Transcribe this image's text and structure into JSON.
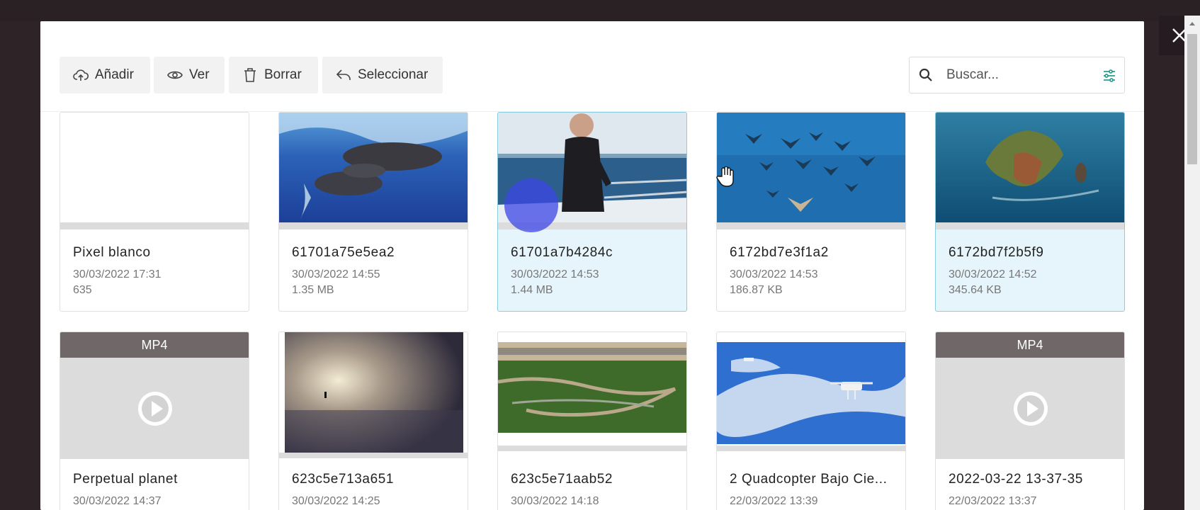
{
  "toolbar": {
    "add_label": "Añadir",
    "view_label": "Ver",
    "delete_label": "Borrar",
    "select_label": "Seleccionar"
  },
  "search": {
    "placeholder": "Buscar..."
  },
  "colors": {
    "selected_card_bg": "#e6f5fc",
    "selected_card_border": "#8ccbe0",
    "video_label_bg": "#706769"
  },
  "files": [
    {
      "name": "Pixel blanco",
      "date": "30/03/2022 17:31",
      "size": "635",
      "kind": "blank",
      "selected": false
    },
    {
      "name": "61701a75e5ea2",
      "date": "30/03/2022 14:55",
      "size": "1.35 MB",
      "kind": "image",
      "picture": "sperm whales underwater",
      "selected": false
    },
    {
      "name": "61701a7b4284c",
      "date": "30/03/2022 14:53",
      "size": "1.44 MB",
      "kind": "image",
      "picture": "diver on boat",
      "selected": true
    },
    {
      "name": "6172bd7e3f1a2",
      "date": "30/03/2022 14:53",
      "size": "186.87 KB",
      "kind": "image",
      "picture": "school of manta rays",
      "selected": false
    },
    {
      "name": "6172bd7f2b5f9",
      "date": "30/03/2022 14:52",
      "size": "345.64 KB",
      "kind": "image",
      "picture": "aerial island",
      "selected": true
    },
    {
      "name": "Perpetual planet",
      "date": "30/03/2022 14:37",
      "kind": "video",
      "type_label": "MP4",
      "selected": false
    },
    {
      "name": "623c5e713a651",
      "date": "30/03/2022 14:25",
      "kind": "image",
      "picture": "person in misty sunrise",
      "selected": false
    },
    {
      "name": "623c5e71aab52",
      "date": "30/03/2022 14:18",
      "kind": "image",
      "picture": "winding river rainforest",
      "selected": false
    },
    {
      "name": "2 Quadcopter Bajo Cie...",
      "date": "22/03/2022 13:39",
      "kind": "image",
      "picture": "drones in blue sky",
      "selected": false
    },
    {
      "name": "2022-03-22 13-37-35",
      "date": "22/03/2022 13:37",
      "kind": "video",
      "type_label": "MP4",
      "selected": false
    }
  ]
}
